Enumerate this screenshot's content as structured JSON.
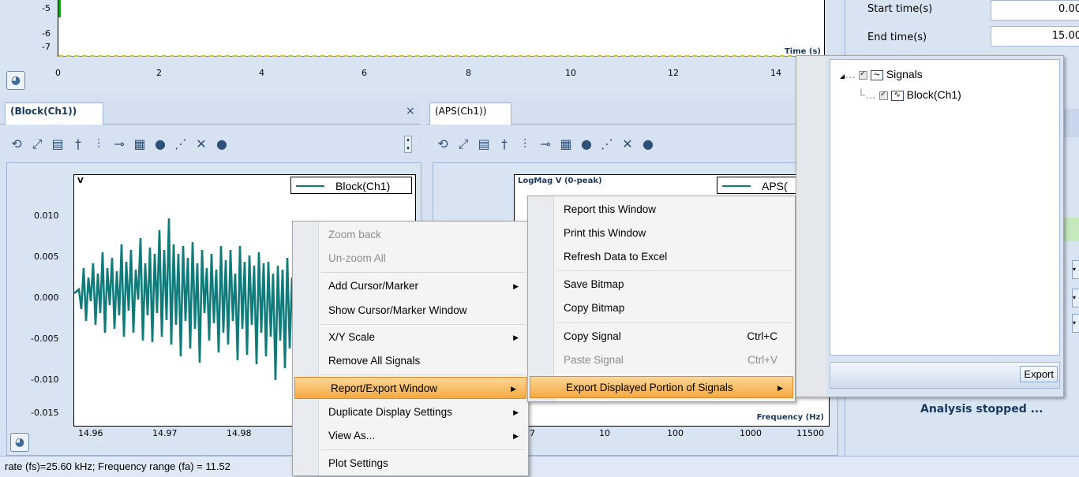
{
  "top_plot": {
    "y_ticks": [
      "-5",
      "-6",
      "-7"
    ],
    "x_ticks": [
      "0",
      "2",
      "4",
      "6",
      "8",
      "10",
      "12",
      "14"
    ],
    "x_label": "Time (s)"
  },
  "right_panel": {
    "start_time_label": "Start time(s)",
    "start_time_value": "0.00",
    "end_time_label": "End time(s)",
    "end_time_value": "15.00",
    "status_text": "Analysis stopped ..."
  },
  "left_pane": {
    "tab_label": "(Block(Ch1))",
    "close_glyph": "×",
    "y_unit": "V",
    "legend": "Block(Ch1)",
    "y_ticks": [
      "0.010",
      "0.005",
      "0.000",
      "-0.005",
      "-0.010",
      "-0.015"
    ],
    "x_ticks": [
      "14.96",
      "14.97",
      "14.98"
    ]
  },
  "right_pane": {
    "tab_label": "(APS(Ch1))",
    "y_unit": "LogMag V (0-peak)",
    "legend": "APS(",
    "x_ticks": [
      "7",
      "10",
      "100",
      "1000",
      "11500"
    ],
    "x_label": "Frequency (Hz)"
  },
  "status_bar": {
    "text": "rate (fs)=25.60 kHz; Frequency range (fa) = 11.52"
  },
  "context_menu": {
    "items": [
      {
        "label": "Zoom back",
        "disabled": true
      },
      {
        "label": "Un-zoom All",
        "disabled": true
      },
      {
        "label": "Add Cursor/Marker",
        "arrow": true
      },
      {
        "label": "Show Cursor/Marker Window"
      },
      {
        "label": "X/Y Scale",
        "arrow": true
      },
      {
        "label": "Remove All Signals"
      },
      {
        "label": "Report/Export Window",
        "arrow": true,
        "highlighted": true
      },
      {
        "label": "Duplicate Display Settings",
        "arrow": true
      },
      {
        "label": "View As...",
        "arrow": true
      },
      {
        "label": "Plot Settings"
      }
    ],
    "arrow_glyph": "▶"
  },
  "submenu": {
    "items": [
      {
        "label": "Report this Window"
      },
      {
        "label": "Print this Window"
      },
      {
        "label": "Refresh Data to Excel"
      },
      {
        "label": "Save Bitmap"
      },
      {
        "label": "Copy Bitmap"
      },
      {
        "label": "Copy Signal",
        "shortcut": "Ctrl+C"
      },
      {
        "label": "Paste Signal",
        "shortcut": "Ctrl+V",
        "disabled": true
      },
      {
        "label": "Export Displayed Portion of Signals",
        "arrow": true,
        "highlighted": true
      }
    ]
  },
  "export_panel": {
    "tree_root": "Signals",
    "tree_child": "Block(Ch1)",
    "export_button": "Export"
  },
  "colors": {
    "signal": "#0f7b7b",
    "highlight": "#f5a941"
  }
}
